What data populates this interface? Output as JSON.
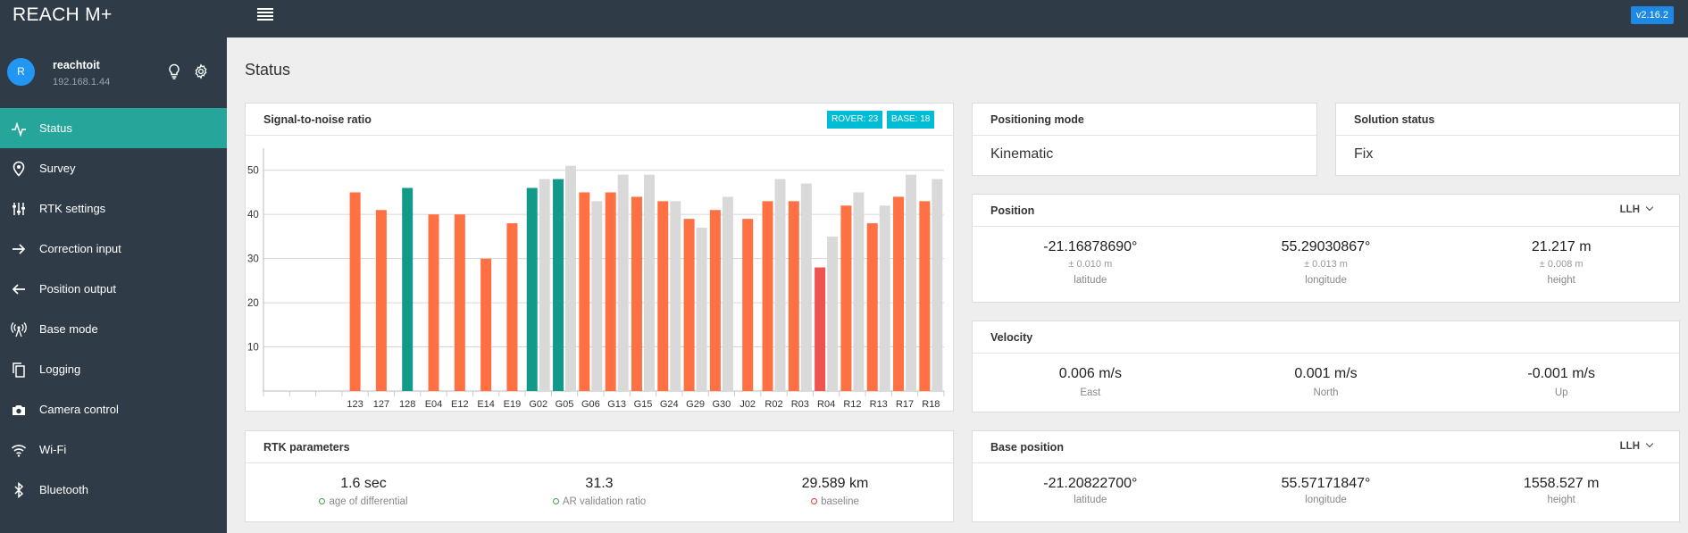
{
  "app": {
    "title": "REACH M+",
    "version": "v2.16.2"
  },
  "user": {
    "avatar_letter": "R",
    "name": "reachtoit",
    "ip": "192.168.1.44"
  },
  "nav": [
    {
      "label": "Status",
      "icon": "pulse-icon",
      "active": true
    },
    {
      "label": "Survey",
      "icon": "map-pin-icon"
    },
    {
      "label": "RTK settings",
      "icon": "sliders-icon"
    },
    {
      "label": "Correction input",
      "icon": "arrow-right-icon"
    },
    {
      "label": "Position output",
      "icon": "arrow-left-icon"
    },
    {
      "label": "Base mode",
      "icon": "antenna-icon"
    },
    {
      "label": "Logging",
      "icon": "copy-icon"
    },
    {
      "label": "Camera control",
      "icon": "camera-icon"
    },
    {
      "label": "Wi-Fi",
      "icon": "wifi-icon"
    },
    {
      "label": "Bluetooth",
      "icon": "bluetooth-icon"
    }
  ],
  "page_title": "Status",
  "snr": {
    "title": "Signal-to-noise ratio",
    "rover_badge": "ROVER: 23",
    "base_badge": "BASE: 18"
  },
  "chart_data": {
    "type": "bar",
    "title": "Signal-to-noise ratio",
    "ylim": [
      0,
      55
    ],
    "yticks": [
      10,
      20,
      30,
      40,
      50
    ],
    "grid": true,
    "categories": [
      "123",
      "127",
      "128",
      "E04",
      "E12",
      "E14",
      "E19",
      "G02",
      "G05",
      "G06",
      "G13",
      "G15",
      "G24",
      "G29",
      "G30",
      "J02",
      "R02",
      "R03",
      "R04",
      "R12",
      "R13",
      "R17",
      "R18"
    ],
    "series": [
      {
        "values": [
          45,
          41,
          46,
          40,
          40,
          30,
          38,
          46,
          48,
          45,
          45,
          44,
          43,
          39,
          41,
          39,
          43,
          43,
          28,
          42,
          38,
          44,
          43
        ]
      },
      {
        "values": [
          null,
          null,
          null,
          null,
          null,
          null,
          null,
          48,
          51,
          43,
          49,
          49,
          43,
          37,
          44,
          null,
          48,
          47,
          35,
          45,
          42,
          49,
          48
        ]
      }
    ],
    "colors": {
      "rover": "#ff7043",
      "rover_fix": "#11998a",
      "rover_low": "#ef5350",
      "base": "#d9d9d9"
    },
    "rover_fix_categories": [
      "128",
      "G02",
      "G05"
    ],
    "rover_low_categories": [
      "R04"
    ],
    "ylabel": "",
    "xlabel": ""
  },
  "positioning_mode": {
    "title": "Positioning mode",
    "value": "Kinematic"
  },
  "solution_status": {
    "title": "Solution status",
    "value": "Fix"
  },
  "position": {
    "title": "Position",
    "format": "LLH",
    "cols": [
      {
        "value": "-21.16878690°",
        "sub": "± 0.010 m",
        "label": "latitude"
      },
      {
        "value": "55.29030867°",
        "sub": "± 0.013 m",
        "label": "longitude"
      },
      {
        "value": "21.217 m",
        "sub": "± 0.008 m",
        "label": "height"
      }
    ]
  },
  "velocity": {
    "title": "Velocity",
    "cols": [
      {
        "value": "0.006 m/s",
        "label": "East"
      },
      {
        "value": "0.001 m/s",
        "label": "North"
      },
      {
        "value": "-0.001 m/s",
        "label": "Up"
      }
    ]
  },
  "rtk_params": {
    "title": "RTK parameters",
    "cols": [
      {
        "value": "1.6 sec",
        "label": "age of differential",
        "status": "green"
      },
      {
        "value": "31.3",
        "label": "AR validation ratio",
        "status": "green"
      },
      {
        "value": "29.589 km",
        "label": "baseline",
        "status": "red"
      }
    ]
  },
  "base_position": {
    "title": "Base position",
    "format": "LLH",
    "cols": [
      {
        "value": "-21.20822700°",
        "label": "latitude"
      },
      {
        "value": "55.57171847°",
        "label": "longitude"
      },
      {
        "value": "1558.527 m",
        "label": "height"
      }
    ]
  }
}
